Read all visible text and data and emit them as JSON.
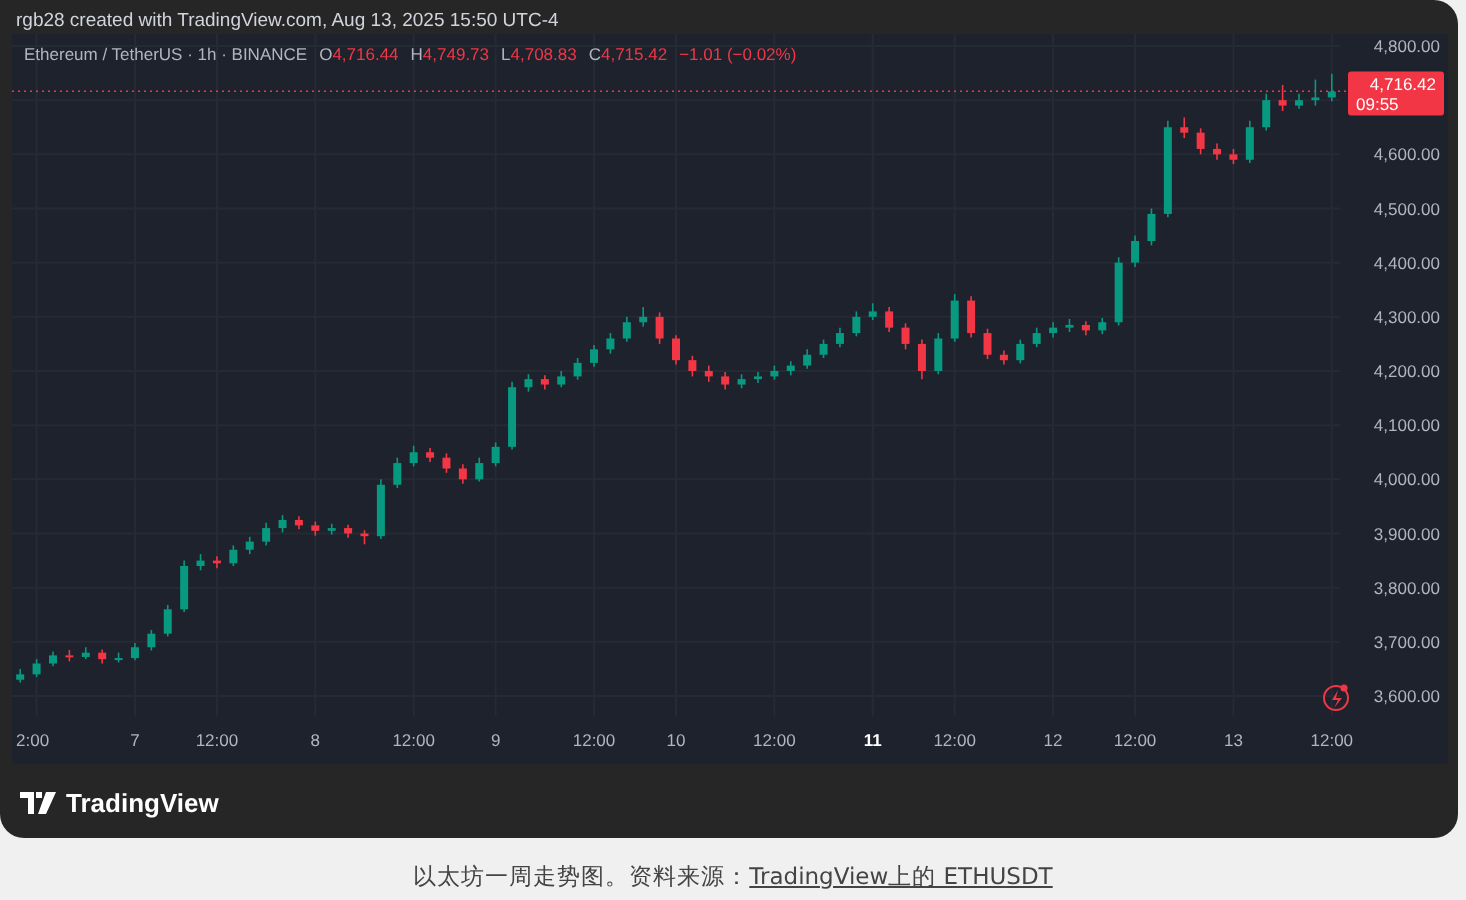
{
  "header": "rgb28 created with TradingView.com, Aug 13, 2025 15:50 UTC-4",
  "legend": {
    "symbol": "Ethereum / TetherUS · 1h · BINANCE",
    "ohlc": [
      {
        "label": "O",
        "value": "4,716.44"
      },
      {
        "label": "H",
        "value": "4,749.73"
      },
      {
        "label": "L",
        "value": "4,708.83"
      },
      {
        "label": "C",
        "value": "4,715.42"
      }
    ],
    "change": "−1.01 (−0.02%)"
  },
  "price_tag": {
    "price": "4,716.42",
    "countdown": "09:55"
  },
  "chart_data": {
    "type": "candlestick",
    "grid": true,
    "ref_lines": [
      {
        "axis": "y",
        "value": 4716.42,
        "color": "#f23645"
      }
    ],
    "ylim": [
      3600,
      4800
    ],
    "yticks": [
      {
        "value": 4800,
        "label": "4,800.00"
      },
      {
        "value": 4600,
        "label": "4,600.00"
      },
      {
        "value": 4500,
        "label": "4,500.00"
      },
      {
        "value": 4400,
        "label": "4,400.00"
      },
      {
        "value": 4300,
        "label": "4,300.00"
      },
      {
        "value": 4200,
        "label": "4,200.00"
      },
      {
        "value": 4100,
        "label": "4,100.00"
      },
      {
        "value": 4000,
        "label": "4,000.00"
      },
      {
        "value": 3900,
        "label": "3,900.00"
      },
      {
        "value": 3800,
        "label": "3,800.00"
      },
      {
        "value": 3700,
        "label": "3,700.00"
      },
      {
        "value": 3600,
        "label": "3,600.00"
      }
    ],
    "categories": [
      null,
      "2:00",
      null,
      null,
      null,
      null,
      null,
      "7",
      null,
      null,
      null,
      null,
      "12:00",
      null,
      null,
      null,
      null,
      null,
      "8",
      null,
      null,
      null,
      null,
      null,
      "12:00",
      null,
      null,
      null,
      null,
      "9",
      null,
      null,
      null,
      null,
      null,
      "12:00",
      null,
      null,
      null,
      null,
      "10",
      null,
      null,
      null,
      null,
      null,
      "12:00",
      null,
      null,
      null,
      null,
      null,
      "11",
      null,
      null,
      null,
      null,
      "12:00",
      null,
      null,
      null,
      null,
      null,
      "12",
      null,
      null,
      null,
      null,
      "12:00",
      null,
      null,
      null,
      null,
      null,
      "13",
      null,
      null,
      null,
      null,
      null,
      "12:00"
    ],
    "ohlc": [
      [
        3630,
        3650,
        3625,
        3640
      ],
      [
        3640,
        3668,
        3635,
        3660
      ],
      [
        3660,
        3682,
        3655,
        3675
      ],
      [
        3675,
        3685,
        3664,
        3672
      ],
      [
        3672,
        3690,
        3668,
        3680
      ],
      [
        3680,
        3686,
        3660,
        3668
      ],
      [
        3668,
        3680,
        3662,
        3670
      ],
      [
        3670,
        3698,
        3666,
        3690
      ],
      [
        3690,
        3722,
        3684,
        3715
      ],
      [
        3715,
        3768,
        3710,
        3760
      ],
      [
        3760,
        3850,
        3755,
        3840
      ],
      [
        3840,
        3862,
        3832,
        3850
      ],
      [
        3850,
        3858,
        3836,
        3845
      ],
      [
        3845,
        3878,
        3840,
        3870
      ],
      [
        3870,
        3894,
        3862,
        3885
      ],
      [
        3885,
        3920,
        3878,
        3910
      ],
      [
        3910,
        3934,
        3902,
        3925
      ],
      [
        3925,
        3932,
        3908,
        3915
      ],
      [
        3915,
        3922,
        3896,
        3905
      ],
      [
        3905,
        3918,
        3898,
        3910
      ],
      [
        3910,
        3916,
        3892,
        3900
      ],
      [
        3900,
        3906,
        3880,
        3895
      ],
      [
        3895,
        4000,
        3890,
        3990
      ],
      [
        3990,
        4040,
        3984,
        4030
      ],
      [
        4030,
        4062,
        4024,
        4050
      ],
      [
        4050,
        4058,
        4032,
        4040
      ],
      [
        4040,
        4048,
        4012,
        4020
      ],
      [
        4020,
        4028,
        3992,
        4000
      ],
      [
        4000,
        4040,
        3996,
        4030
      ],
      [
        4030,
        4068,
        4024,
        4060
      ],
      [
        4060,
        4180,
        4055,
        4170
      ],
      [
        4170,
        4194,
        4162,
        4185
      ],
      [
        4185,
        4192,
        4166,
        4175
      ],
      [
        4175,
        4200,
        4170,
        4190
      ],
      [
        4190,
        4224,
        4184,
        4215
      ],
      [
        4215,
        4248,
        4208,
        4240
      ],
      [
        4240,
        4270,
        4232,
        4260
      ],
      [
        4260,
        4300,
        4254,
        4290
      ],
      [
        4290,
        4318,
        4282,
        4300
      ],
      [
        4300,
        4308,
        4250,
        4260
      ],
      [
        4260,
        4266,
        4212,
        4220
      ],
      [
        4220,
        4228,
        4190,
        4200
      ],
      [
        4200,
        4210,
        4180,
        4190
      ],
      [
        4190,
        4198,
        4166,
        4175
      ],
      [
        4175,
        4194,
        4168,
        4185
      ],
      [
        4185,
        4198,
        4178,
        4190
      ],
      [
        4190,
        4210,
        4184,
        4200
      ],
      [
        4200,
        4218,
        4192,
        4210
      ],
      [
        4210,
        4240,
        4204,
        4230
      ],
      [
        4230,
        4258,
        4224,
        4250
      ],
      [
        4250,
        4280,
        4244,
        4270
      ],
      [
        4270,
        4310,
        4264,
        4300
      ],
      [
        4300,
        4325,
        4294,
        4310
      ],
      [
        4310,
        4318,
        4272,
        4280
      ],
      [
        4280,
        4288,
        4240,
        4250
      ],
      [
        4250,
        4258,
        4185,
        4200
      ],
      [
        4200,
        4270,
        4194,
        4260
      ],
      [
        4260,
        4342,
        4254,
        4330
      ],
      [
        4330,
        4338,
        4262,
        4270
      ],
      [
        4270,
        4278,
        4222,
        4230
      ],
      [
        4230,
        4238,
        4212,
        4220
      ],
      [
        4220,
        4258,
        4214,
        4250
      ],
      [
        4250,
        4280,
        4244,
        4270
      ],
      [
        4270,
        4290,
        4262,
        4280
      ],
      [
        4280,
        4296,
        4272,
        4285
      ],
      [
        4285,
        4292,
        4266,
        4275
      ],
      [
        4275,
        4298,
        4268,
        4290
      ],
      [
        4290,
        4410,
        4284,
        4400
      ],
      [
        4400,
        4450,
        4392,
        4440
      ],
      [
        4440,
        4500,
        4432,
        4490
      ],
      [
        4490,
        4662,
        4484,
        4650
      ],
      [
        4650,
        4668,
        4630,
        4640
      ],
      [
        4640,
        4648,
        4600,
        4610
      ],
      [
        4610,
        4620,
        4590,
        4600
      ],
      [
        4600,
        4610,
        4582,
        4590
      ],
      [
        4590,
        4662,
        4584,
        4650
      ],
      [
        4650,
        4712,
        4644,
        4700
      ],
      [
        4700,
        4728,
        4680,
        4690
      ],
      [
        4690,
        4712,
        4684,
        4700
      ],
      [
        4700,
        4738,
        4690,
        4705
      ],
      [
        4705,
        4749,
        4698,
        4716
      ]
    ]
  },
  "x_axis": [
    {
      "bold": false
    },
    {
      "bold": false
    },
    {
      "bold": false
    },
    {
      "bold": false
    },
    {
      "bold": false
    },
    {
      "bold": false
    },
    {
      "bold": false
    },
    {
      "bold": false
    },
    {
      "bold": false
    },
    {
      "bold": true
    },
    {
      "bold": false
    },
    {
      "bold": false
    },
    {
      "bold": false
    },
    {
      "bold": false
    },
    {
      "bold": false
    }
  ],
  "logo": "TradingView",
  "caption": {
    "text": "以太坊一周走势图。资料来源：",
    "link": "TradingView上的 ETHUSDT"
  }
}
